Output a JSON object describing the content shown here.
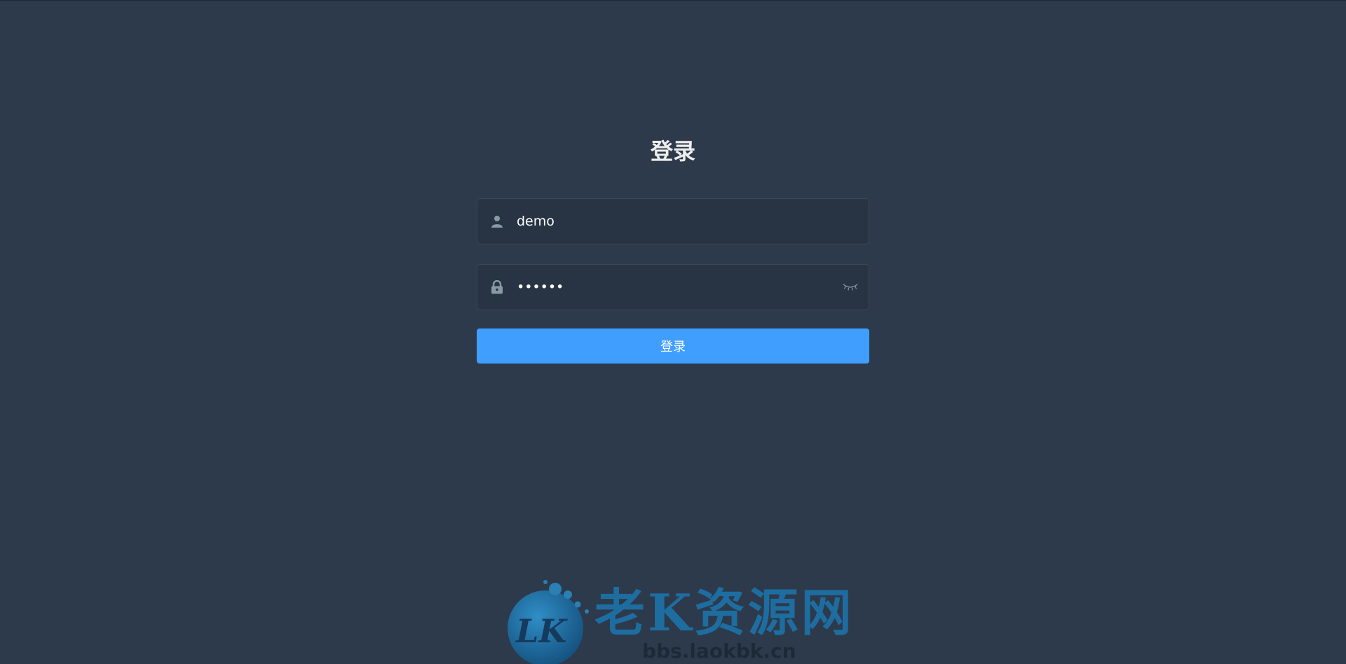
{
  "login": {
    "title": "登录",
    "username": {
      "value": "demo",
      "icon": "user-icon"
    },
    "password": {
      "value": "••••••",
      "icon": "lock-icon",
      "toggle_icon": "eye-closed-icon"
    },
    "submit_label": "登录"
  },
  "watermark": {
    "brand": "老K资源网",
    "url": "bbs.laokbk.cn"
  },
  "colors": {
    "background": "#2d3a4b",
    "field_background": "#283443",
    "primary": "#409eff",
    "icon": "#889aa4",
    "watermark_blue": "#1e6da1"
  }
}
